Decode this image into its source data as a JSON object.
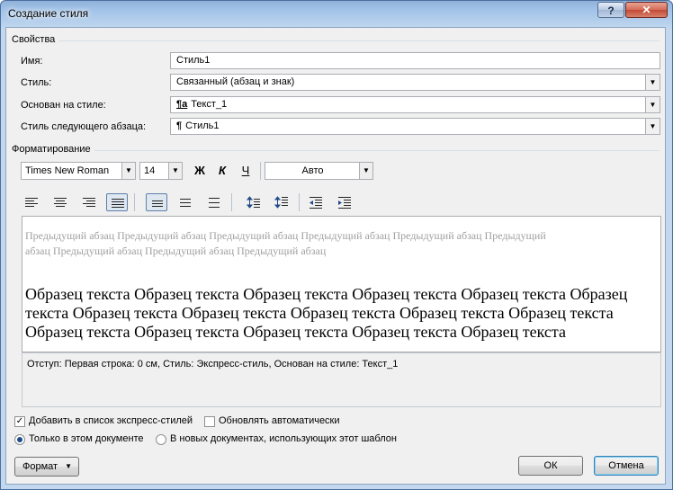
{
  "window": {
    "title": "Создание стиля",
    "help": "?",
    "close": "✕"
  },
  "properties": {
    "group_label": "Свойства",
    "name_label": "Имя:",
    "name_value": "Стиль1",
    "style_type_label": "Стиль:",
    "style_type_value": "Связанный (абзац и знак)",
    "based_on_label": "Основан на стиле:",
    "based_on_icon": "¶a",
    "based_on_value": "Текст_1",
    "next_label": "Стиль следующего абзаца:",
    "next_icon": "¶",
    "next_value": "Стиль1"
  },
  "formatting": {
    "group_label": "Форматирование",
    "font": "Times New Roman",
    "size": "14",
    "bold": "Ж",
    "italic": "К",
    "underline": "Ч",
    "color": "Авто"
  },
  "toolbar_icons": [
    "align-left-icon",
    "align-center-icon",
    "align-right-icon",
    "align-justify-icon",
    "single-spacing-icon",
    "one-half-spacing-icon",
    "double-spacing-icon",
    "space-before-icon",
    "space-after-icon",
    "decrease-indent-icon",
    "increase-indent-icon"
  ],
  "preview": {
    "previous": "Предыдущий абзац Предыдущий абзац Предыдущий абзац Предыдущий абзац Предыдущий абзац Предыдущий абзац Предыдущий абзац Предыдущий абзац Предыдущий абзац",
    "sample": "Образец текста Образец текста Образец текста Образец текста Образец текста Образец текста Образец текста Образец текста Образец текста Образец текста Образец текста Образец текста Образец текста Образец текста Образец текста Образец текста"
  },
  "description": "Отступ: Первая строка:  0 см, Стиль: Экспресс-стиль, Основан на стиле: Текст_1",
  "options": {
    "add_quick": "Добавить в список экспресс-стилей",
    "add_quick_checked": true,
    "auto_update": "Обновлять автоматически",
    "auto_update_checked": false,
    "only_doc": "Только в этом документе",
    "new_docs": "В новых документах, использующих этот шаблон"
  },
  "buttons": {
    "format": "Формат",
    "ok": "ОК",
    "cancel": "Отмена"
  }
}
